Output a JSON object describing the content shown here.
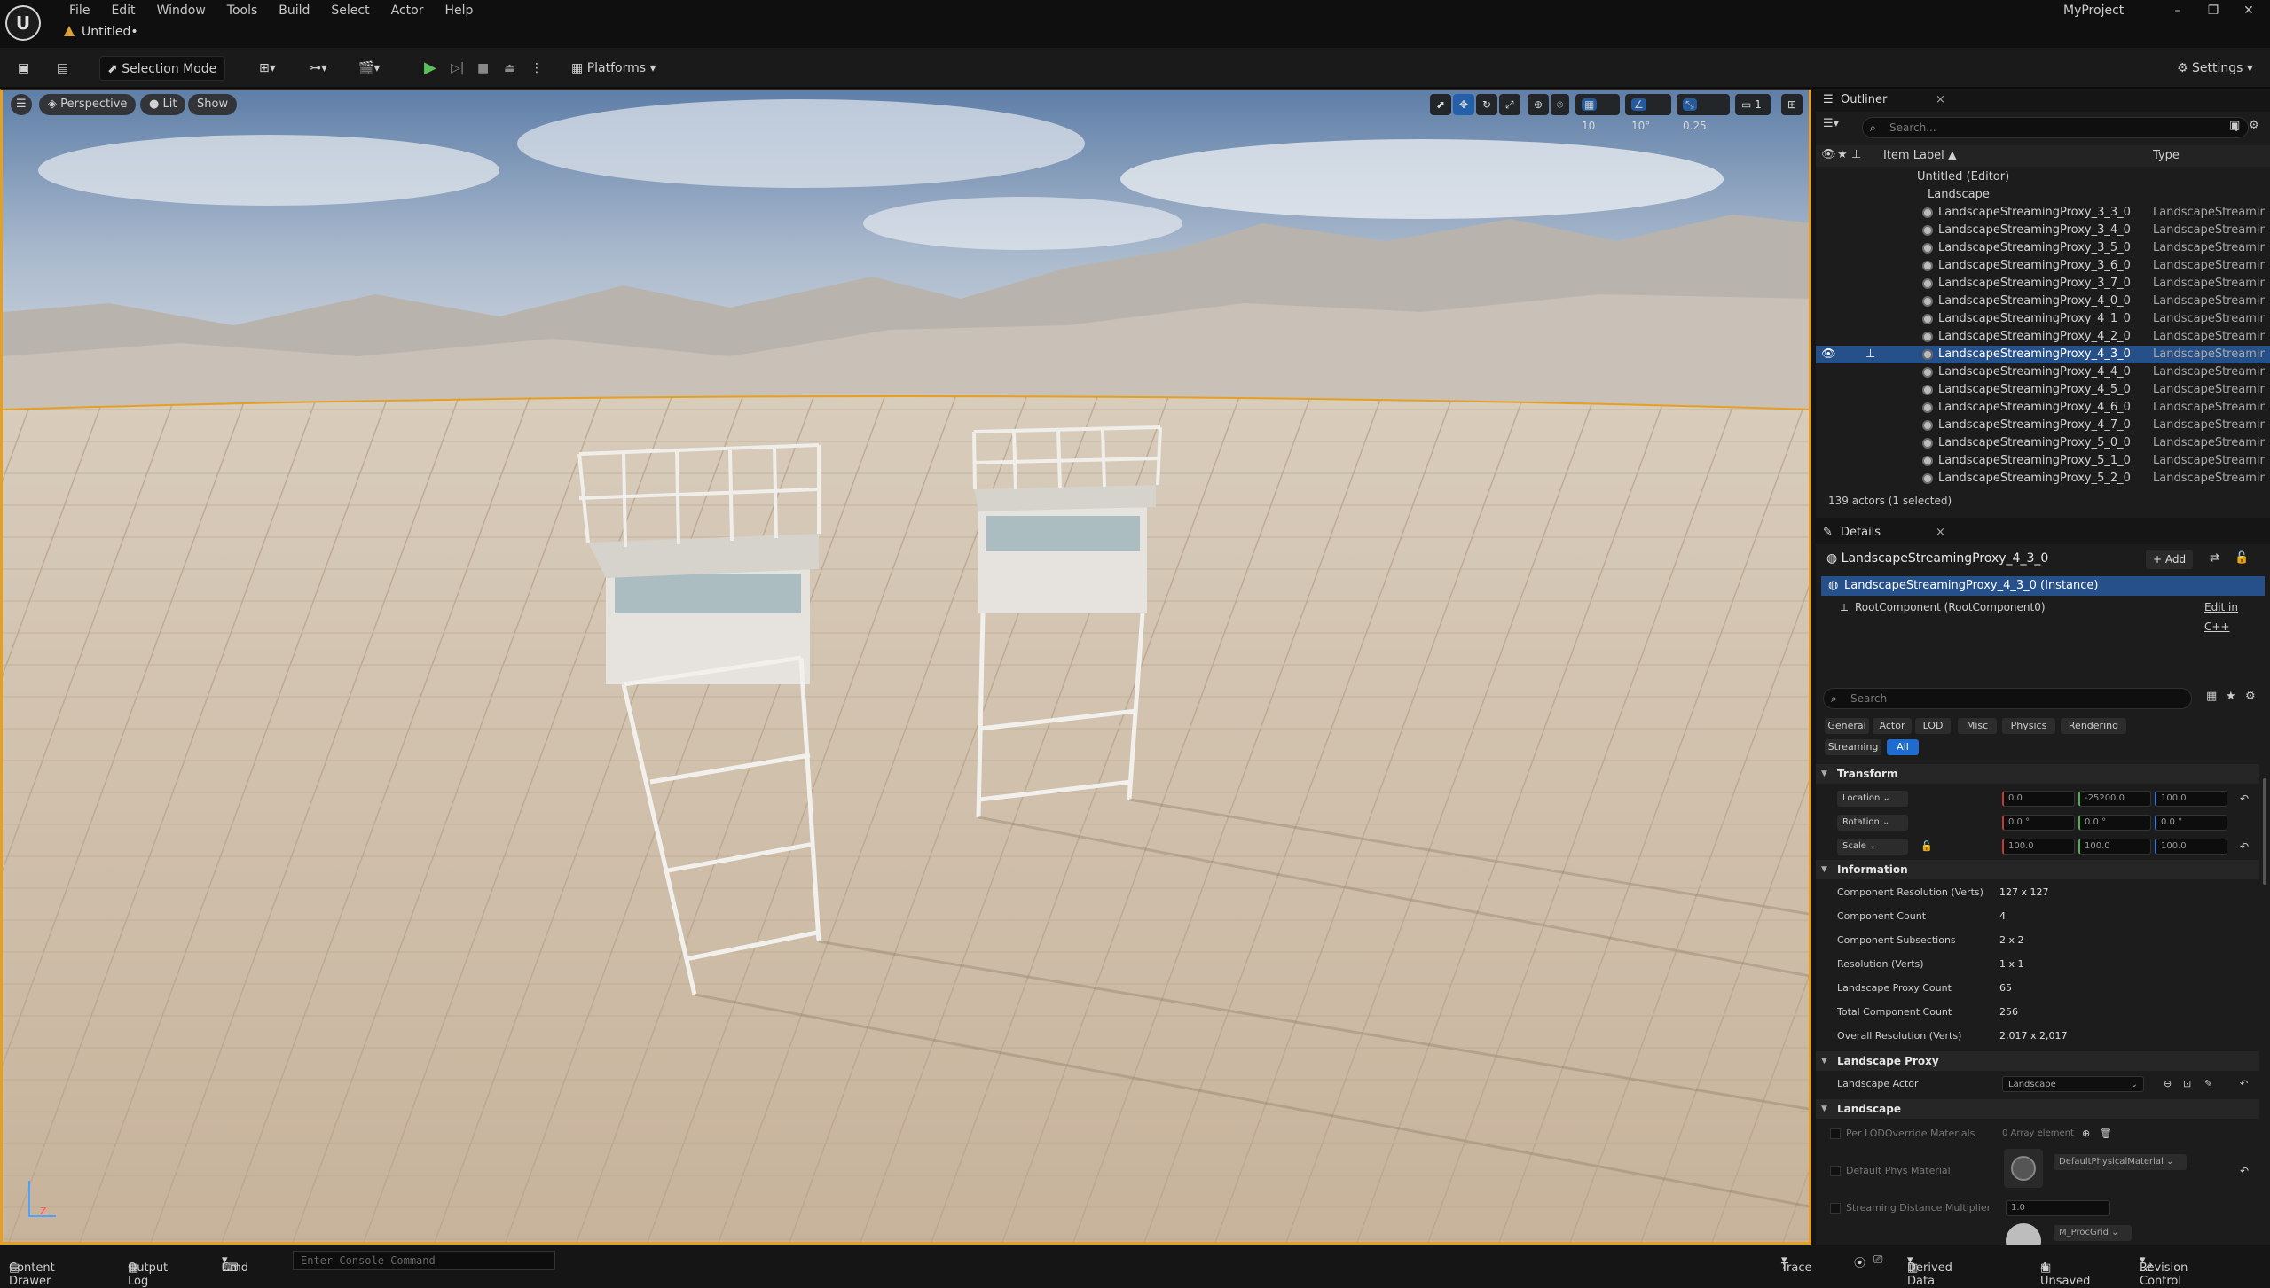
{
  "app": {
    "project_name": "MyProject",
    "document_tab": "Untitled•",
    "logo_text": "U"
  },
  "menu": [
    "File",
    "Edit",
    "Window",
    "Tools",
    "Build",
    "Select",
    "Actor",
    "Help"
  ],
  "window_controls": {
    "minimize": "–",
    "maximize": "❐",
    "close": "✕"
  },
  "toolbar": {
    "selection_mode": "Selection Mode",
    "platforms": "Platforms",
    "settings": "Settings"
  },
  "viewport": {
    "perspective": "Perspective",
    "lit": "Lit",
    "show": "Show",
    "grid_snap": "10",
    "rotation_snap": "10°",
    "scale_snap": "0.25",
    "camera_speed": "1",
    "axis_label": "z"
  },
  "outliner": {
    "title": "Outliner",
    "search_placeholder": "Search...",
    "col_label": "Item Label ▲",
    "col_type": "Type",
    "world": "Untitled (Editor)",
    "landscape": "Landscape",
    "items": [
      {
        "label": "LandscapeStreamingProxy_3_3_0",
        "type": "LandscapeStreamingProxy"
      },
      {
        "label": "LandscapeStreamingProxy_3_4_0",
        "type": "LandscapeStreamingProxy"
      },
      {
        "label": "LandscapeStreamingProxy_3_5_0",
        "type": "LandscapeStreamingProxy"
      },
      {
        "label": "LandscapeStreamingProxy_3_6_0",
        "type": "LandscapeStreamingProxy"
      },
      {
        "label": "LandscapeStreamingProxy_3_7_0",
        "type": "LandscapeStreamingProxy"
      },
      {
        "label": "LandscapeStreamingProxy_4_0_0",
        "type": "LandscapeStreamingProxy"
      },
      {
        "label": "LandscapeStreamingProxy_4_1_0",
        "type": "LandscapeStreamingProxy"
      },
      {
        "label": "LandscapeStreamingProxy_4_2_0",
        "type": "LandscapeStreamingProxy"
      },
      {
        "label": "LandscapeStreamingProxy_4_3_0",
        "type": "LandscapeStreamingProxy"
      },
      {
        "label": "LandscapeStreamingProxy_4_4_0",
        "type": "LandscapeStreamingProxy"
      },
      {
        "label": "LandscapeStreamingProxy_4_5_0",
        "type": "LandscapeStreamingProxy"
      },
      {
        "label": "LandscapeStreamingProxy_4_6_0",
        "type": "LandscapeStreamingProxy"
      },
      {
        "label": "LandscapeStreamingProxy_4_7_0",
        "type": "LandscapeStreamingProxy"
      },
      {
        "label": "LandscapeStreamingProxy_5_0_0",
        "type": "LandscapeStreamingProxy"
      },
      {
        "label": "LandscapeStreamingProxy_5_1_0",
        "type": "LandscapeStreamingProxy"
      },
      {
        "label": "LandscapeStreamingProxy_5_2_0",
        "type": "LandscapeStreamingProxy"
      }
    ],
    "footer": "139 actors (1 selected)"
  },
  "details": {
    "title": "Details",
    "actor_name": "LandscapeStreamingProxy_4_3_0",
    "add_label": "+ Add",
    "instance": "LandscapeStreamingProxy_4_3_0 (Instance)",
    "root_component": "RootComponent (RootComponent0)",
    "edit_cpp": "Edit in C++",
    "search_placeholder": "Search",
    "filter_tabs": [
      "General",
      "Actor",
      "LOD",
      "Misc",
      "Physics",
      "Rendering",
      "Streaming",
      "All"
    ],
    "transform": {
      "title": "Transform",
      "location": {
        "label": "Location",
        "x": "0.0",
        "y": "-25200.0",
        "z": "100.0"
      },
      "rotation": {
        "label": "Rotation",
        "x": "0.0 °",
        "y": "0.0 °",
        "z": "0.0 °"
      },
      "scale": {
        "label": "Scale",
        "x": "100.0",
        "y": "100.0",
        "z": "100.0"
      }
    },
    "information": {
      "title": "Information",
      "rows": [
        {
          "k": "Component Resolution (Verts)",
          "v": "127 x 127"
        },
        {
          "k": "Component Count",
          "v": "4"
        },
        {
          "k": "Component Subsections",
          "v": "2 x 2"
        },
        {
          "k": "Resolution (Verts)",
          "v": "1 x 1"
        },
        {
          "k": "Landscape Proxy Count",
          "v": "65"
        },
        {
          "k": "Total Component Count",
          "v": "256"
        },
        {
          "k": "Overall Resolution (Verts)",
          "v": "2,017 x 2,017"
        }
      ]
    },
    "landscape_proxy": {
      "title": "Landscape Proxy",
      "actor_label": "Landscape Actor",
      "actor_value": "Landscape"
    },
    "landscape": {
      "title": "Landscape",
      "per_lod": "Per LODOverride Materials",
      "per_lod_value": "0 Array element",
      "phys": "Default Phys Material",
      "phys_value": "DefaultPhysicalMaterial",
      "stream": "Streaming Distance Multiplier",
      "stream_value": "1.0",
      "material_value": "M_ProcGrid"
    }
  },
  "statusbar": {
    "content_drawer": "Content Drawer",
    "output_log": "Output Log",
    "cmd": "Cmd",
    "console_placeholder": "Enter Console Command",
    "trace": "Trace",
    "derived": "Derived Data",
    "unsaved": "4 Unsaved",
    "revision": "Revision Control"
  }
}
